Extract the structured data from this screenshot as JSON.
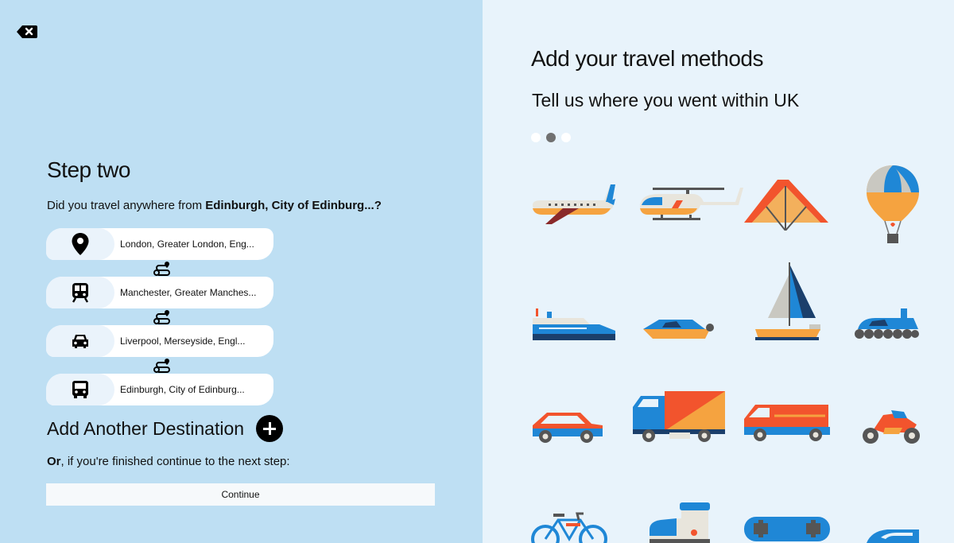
{
  "left": {
    "step_title": "Step two",
    "question_prefix": "Did you travel anywhere from ",
    "question_origin": "Edinburgh, City of Edinburg...?",
    "destinations": [
      {
        "icon": "map-pin-icon",
        "label": "London, Greater London, Eng..."
      },
      {
        "icon": "train-icon",
        "label": "Manchester, Greater Manches..."
      },
      {
        "icon": "car-icon",
        "label": "Liverpool, Merseyside, Engl..."
      },
      {
        "icon": "bus-icon",
        "label": "Edinburgh, City of Edinburg..."
      }
    ],
    "add_label": "Add Another Destination",
    "or_bold": "Or",
    "or_rest": ", if you're finished continue to the next step:",
    "continue_label": "Continue"
  },
  "right": {
    "title": "Add your travel methods",
    "subtitle": "Tell us where you went within UK",
    "pager": {
      "count": 3,
      "active_index": 1
    },
    "vehicles": [
      "airplane-icon",
      "helicopter-icon",
      "hang-glider-icon",
      "hot-air-balloon-icon",
      "ferry-icon",
      "speedboat-icon",
      "sailboat-icon",
      "hovercraft-icon",
      "car-icon",
      "lorry-icon",
      "van-icon",
      "motorbike-icon",
      "bicycle-icon",
      "boot-icon",
      "skateboard-icon",
      "scooter-icon"
    ]
  },
  "colors": {
    "left_bg": "#bedff3",
    "right_bg": "#e8f3fb",
    "blue": "#1f87d6",
    "orange": "#f2542d",
    "amber": "#f5a340",
    "navy": "#1b3f6b"
  }
}
